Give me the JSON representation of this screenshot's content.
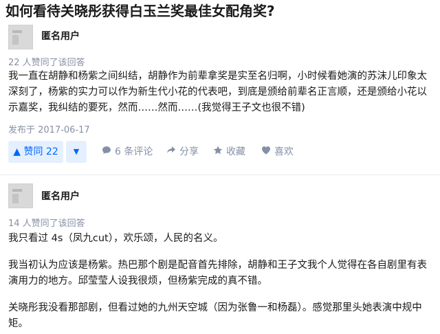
{
  "question": {
    "title": "如何看待关晓彤获得白玉兰奖最佳女配角奖?"
  },
  "answers": [
    {
      "author": "匿名用户",
      "vote_text": "22 人赞同了该回答",
      "paragraphs": [
        "我一直在胡静和杨紫之间纠结，胡静作为前辈拿奖是实至名归啊，小时候看她演的苏沫儿印象太深刻了，杨紫的实力可以作为新生代小花的代表吧，到底是颁给前辈名正言顺，还是颁给小花以示嘉奖，我纠结的要死，然而……然而……(我觉得王子文也很不错)"
      ],
      "date": "发布于 2017-06-17",
      "actions": {
        "vote_up": "▲ 赞同 22",
        "vote_down": "▼",
        "comments": "6 条评论",
        "share": "分享",
        "favorite": "收藏",
        "like": "喜欢"
      }
    },
    {
      "author": "匿名用户",
      "vote_text": "14 人赞同了该回答",
      "paragraphs": [
        "我只看过 4s（凤九cut），欢乐颂，人民的名义。",
        "我当初认为应该是杨紫。热巴那个剧是配音首先排除，胡静和王子文我个人觉得在各自剧里有表演用力的地方。邱莹莹人设我很烦，但杨紫完成的真不错。",
        "关晓彤我没看那部剧，但看过她的九州天空城（因为张鲁一和杨磊）。感觉那里头她表演中规中矩。"
      ]
    }
  ],
  "icons": {
    "comments": "comment-icon",
    "share": "share-icon",
    "favorite": "star-icon",
    "like": "heart-icon"
  },
  "colors": {
    "accent": "#0066ff",
    "accent_bg": "#e5f0ff",
    "meta": "#8590a6",
    "text": "#1a1a1a"
  }
}
